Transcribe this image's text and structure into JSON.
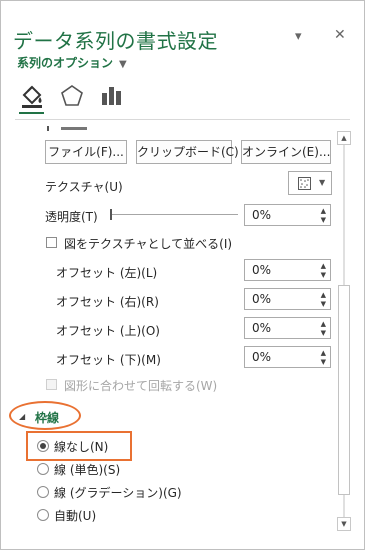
{
  "header": {
    "title": "データ系列の書式設定",
    "dropdown_icon": "▾",
    "close_icon": "✕",
    "subtitle": "系列のオプション",
    "subtitle_arrow": "▼"
  },
  "tabs": [
    {
      "name": "fill-line-icon"
    },
    {
      "name": "effects-pentagon-icon"
    },
    {
      "name": "series-options-bar-icon"
    }
  ],
  "buttons": {
    "file": "ファイル(F)...",
    "clipboard": "クリップボード(C)",
    "online": "オンライン(E)..."
  },
  "texture": {
    "label": "テクスチャ(U)"
  },
  "transparency": {
    "label": "透明度(T)",
    "value": "0%"
  },
  "tile_checkbox": {
    "label": "図をテクスチャとして並べる(I)",
    "checked": false
  },
  "offsets": [
    {
      "label": "オフセット (左)(L)",
      "value": "0%"
    },
    {
      "label": "オフセット (右)(R)",
      "value": "0%"
    },
    {
      "label": "オフセット (上)(O)",
      "value": "0%"
    },
    {
      "label": "オフセット (下)(M)",
      "value": "0%"
    }
  ],
  "rotate_checkbox": {
    "label": "図形に合わせて回転する(W)",
    "checked": false,
    "enabled": false
  },
  "border_section": {
    "label": "枠線",
    "expander": "◢",
    "options": [
      {
        "label": "線なし(N)",
        "selected": true
      },
      {
        "label": "線 (単色)(S)",
        "selected": false
      },
      {
        "label": "線 (グラデーション)(G)",
        "selected": false
      },
      {
        "label": "自動(U)",
        "selected": false
      }
    ]
  },
  "colors": {
    "accent": "#217346",
    "highlight": "#e97132"
  }
}
